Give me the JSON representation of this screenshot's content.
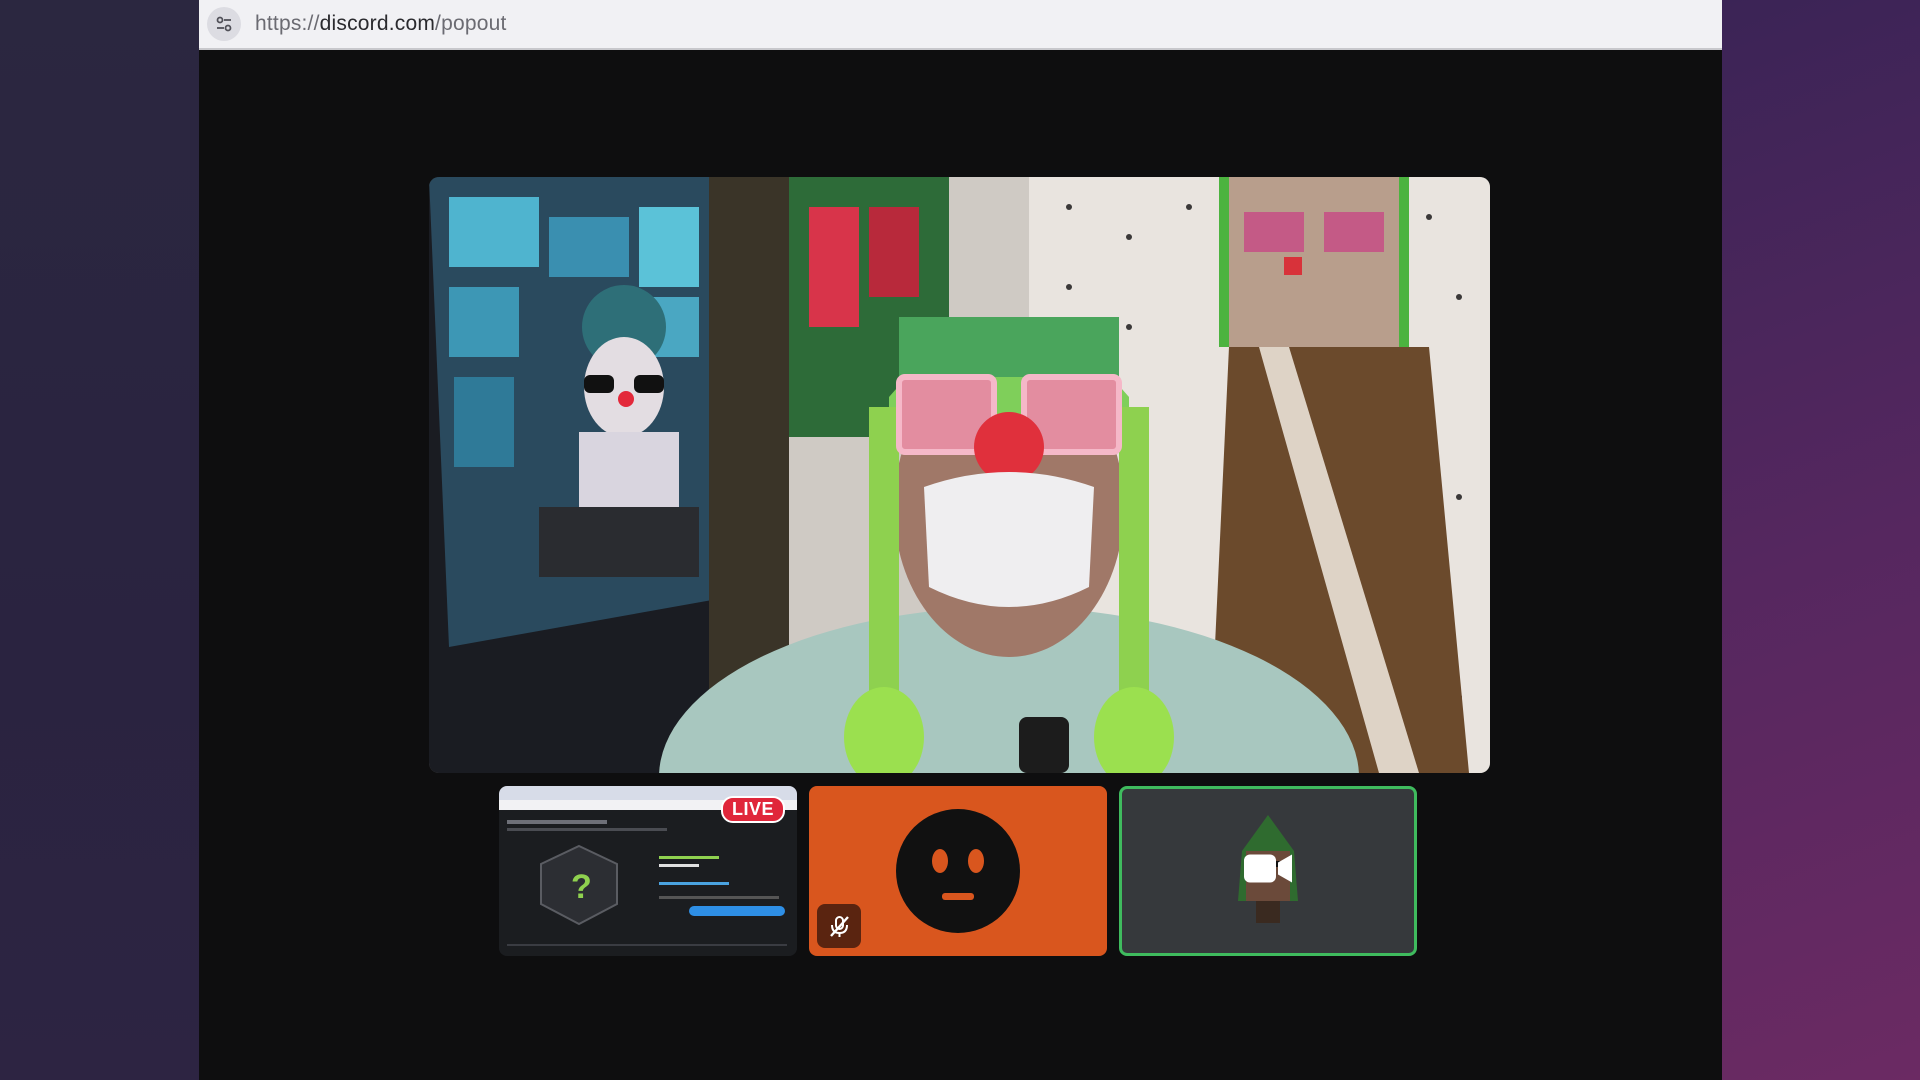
{
  "browser": {
    "url_scheme": "https://",
    "url_host": "discord.com",
    "url_path": "/popout"
  },
  "call": {
    "main_video": "camera-feed-participant",
    "tiles": [
      {
        "type": "screen-share",
        "badge": "LIVE"
      },
      {
        "type": "avatar",
        "muted": true,
        "color": "#d9561e"
      },
      {
        "type": "camera-off",
        "speaking": true,
        "border_color": "#3fbb5e"
      }
    ]
  },
  "colors": {
    "live_red": "#e0263a",
    "avatar_orange": "#d9561e",
    "speaking_green": "#3fbb5e"
  }
}
